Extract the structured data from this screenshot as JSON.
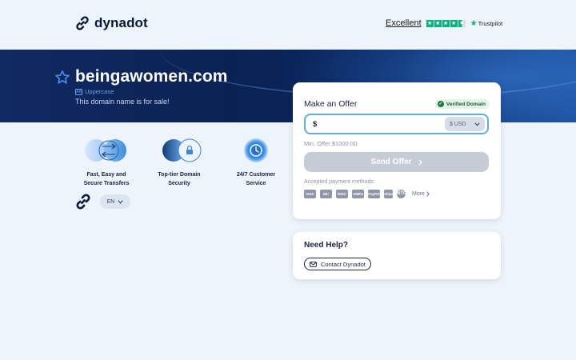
{
  "header": {
    "logo_text": "dynadot",
    "trustpilot": {
      "rating_text": "Excellent",
      "stars": 4.5,
      "brand": "Trustpilot"
    }
  },
  "hero": {
    "domain": "beingawomen.com",
    "case_label": "Uppercase",
    "case_icon_text": "AA",
    "sale_text": "This domain name is for sale!"
  },
  "features": [
    {
      "line1": "Fast, Easy and",
      "line2": "Secure Transfers",
      "icon": "transfer-icon"
    },
    {
      "line1": "Top-tier Domain",
      "line2": "Security",
      "icon": "lock-icon"
    },
    {
      "line1": "24/7 Customer",
      "line2": "Service",
      "icon": "clock-icon"
    }
  ],
  "language": {
    "selected": "EN"
  },
  "offer": {
    "title": "Make an Offer",
    "verified_label": "Verified Domain",
    "currency_symbol": "$",
    "amount_value": "",
    "currency": "$ USD",
    "min_offer": "Min. Offer $1000.00",
    "send_label": "Send Offer",
    "accepted_label": "Accepted payment methods:",
    "payment_methods": [
      "VISA",
      "MC",
      "DISC",
      "AMEX",
      "PayPal",
      "Alipay",
      "BTC"
    ],
    "more_label": "More"
  },
  "help": {
    "title": "Need Help?",
    "contact_label": "Contact Dynadot"
  },
  "colors": {
    "hero_dark": "#0a2253",
    "verified_bg": "#e3f5e8",
    "input_border": "#5fb0d6",
    "send_disabled": "#c6ccd6",
    "trustpilot_green": "#00b67a"
  }
}
